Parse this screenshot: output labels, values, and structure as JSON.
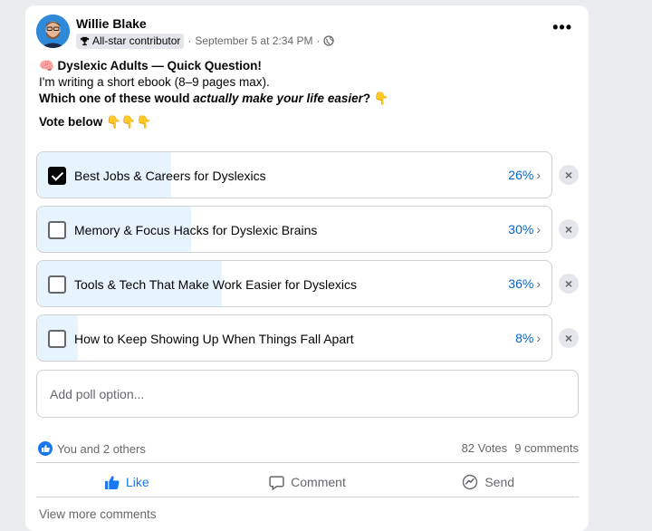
{
  "post": {
    "author": "Willie Blake",
    "badge": "All-star contributor",
    "date": "September 5 at 2:34 PM",
    "dot": "·",
    "more": "•••",
    "line1": "🧠 Dyslexic Adults — Quick Question!",
    "line2": "I'm writing a short ebook (8–9 pages max).",
    "line3_a": "Which one of these would ",
    "line3_em": "actually make your life easier",
    "line3_b": "? 👇",
    "line4": "Vote below 👇👇👇"
  },
  "poll": {
    "options": [
      {
        "label": "Best Jobs & Careers for Dyslexics",
        "percent": "26%",
        "value": 26,
        "checked": true
      },
      {
        "label": "Memory & Focus Hacks for Dyslexic Brains",
        "percent": "30%",
        "value": 30,
        "checked": false
      },
      {
        "label": "Tools & Tech That Make Work Easier for Dyslexics",
        "percent": "36%",
        "value": 36,
        "checked": false
      },
      {
        "label": "How to Keep Showing Up When Things Fall Apart",
        "percent": "8%",
        "value": 8,
        "checked": false
      }
    ],
    "chevron": "›",
    "remove": "×",
    "add_placeholder": "Add poll option..."
  },
  "footer": {
    "reactions": "You and 2 others",
    "votes": "82 Votes",
    "comments": "9 comments",
    "like": "Like",
    "comment": "Comment",
    "send": "Send",
    "view_more": "View more comments"
  },
  "colors": {
    "accent": "#1877f2",
    "fill": "#e7f3ff",
    "percent": "#0064d1"
  }
}
